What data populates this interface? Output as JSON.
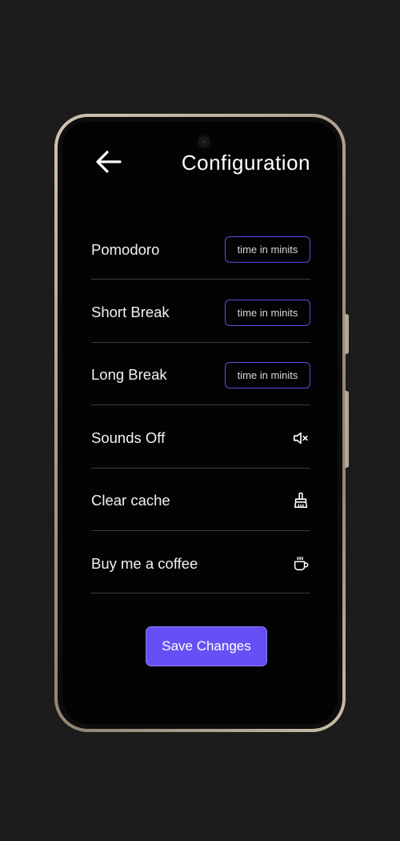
{
  "header": {
    "back_icon": "arrow-left-icon",
    "title": "Configuration"
  },
  "settings": {
    "pomodoro": {
      "label": "Pomodoro",
      "placeholder": "time in minits",
      "value": ""
    },
    "short_break": {
      "label": "Short Break",
      "placeholder": "time in minits",
      "value": ""
    },
    "long_break": {
      "label": "Long Break",
      "placeholder": "time in minits",
      "value": ""
    },
    "sounds": {
      "label": "Sounds Off",
      "icon": "volume-off-icon"
    },
    "cache": {
      "label": "Clear cache",
      "icon": "broom-icon"
    },
    "coffee": {
      "label": "Buy me a coffee",
      "icon": "coffee-cup-icon"
    }
  },
  "actions": {
    "save_label": "Save Changes"
  },
  "colors": {
    "accent": "#6650f5",
    "input_border": "#5a4fe0",
    "background": "#030303",
    "page_background": "#1c1c1c"
  }
}
